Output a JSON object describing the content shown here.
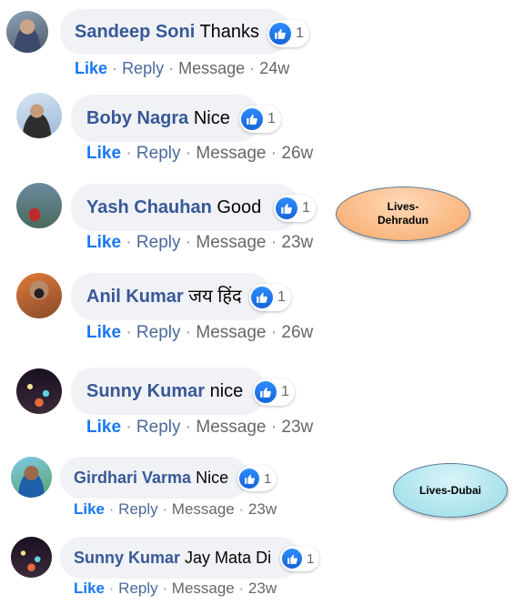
{
  "actions": {
    "like_label": "Like",
    "reply_label": "Reply",
    "message_label": "Message",
    "separator": "·"
  },
  "icons": {
    "reaction": "thumbs-up-icon"
  },
  "colors": {
    "name": "#385898",
    "like_action": "#1877f2",
    "bubble": "#f0f2f5",
    "reaction_badge": "#1877f2"
  },
  "comments": [
    {
      "name": "Sandeep Soni",
      "text": "Thanks",
      "reactions": "1",
      "time": "24w"
    },
    {
      "name": "Boby Nagra",
      "text": "Nice",
      "reactions": "1",
      "time": "26w"
    },
    {
      "name": "Yash Chauhan",
      "text": "Good",
      "reactions": "1",
      "time": "23w"
    },
    {
      "name": "Anil Kumar",
      "text": "जय हिंद",
      "reactions": "1",
      "time": "26w"
    },
    {
      "name": "Sunny Kumar",
      "text": "nice",
      "reactions": "1",
      "time": "23w"
    },
    {
      "name": "Girdhari Varma",
      "text": "Nice",
      "reactions": "1",
      "time": "23w"
    },
    {
      "name": "Sunny Kumar",
      "text": "Jay Mata Di",
      "reactions": "1",
      "time": "23w"
    }
  ],
  "annotations": [
    {
      "text": "Lives-\nDehradun"
    },
    {
      "text": "Lives-Dubai"
    }
  ]
}
